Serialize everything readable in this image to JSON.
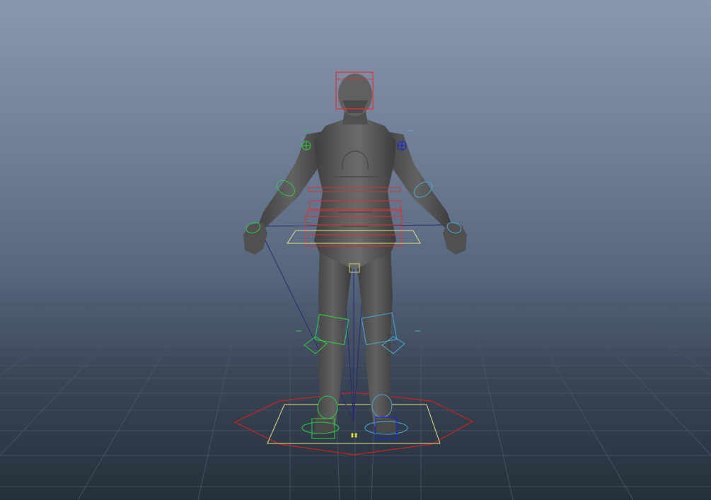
{
  "viewport": {
    "panel": "perspective",
    "background_top": "#8798b0",
    "background_bottom": "#26303c",
    "grid_color": "#4a5666",
    "mesh_color": "#5c5c5c"
  },
  "rig": {
    "character": "humanoid-character-mesh",
    "controls": {
      "head": "#e03030",
      "torso": "#e03030",
      "left_side": "#2ecc40",
      "right_side": "#4aa8d8",
      "right_ik": "#1a2ad8",
      "root": "#e0e080",
      "world": "#d02020"
    }
  }
}
